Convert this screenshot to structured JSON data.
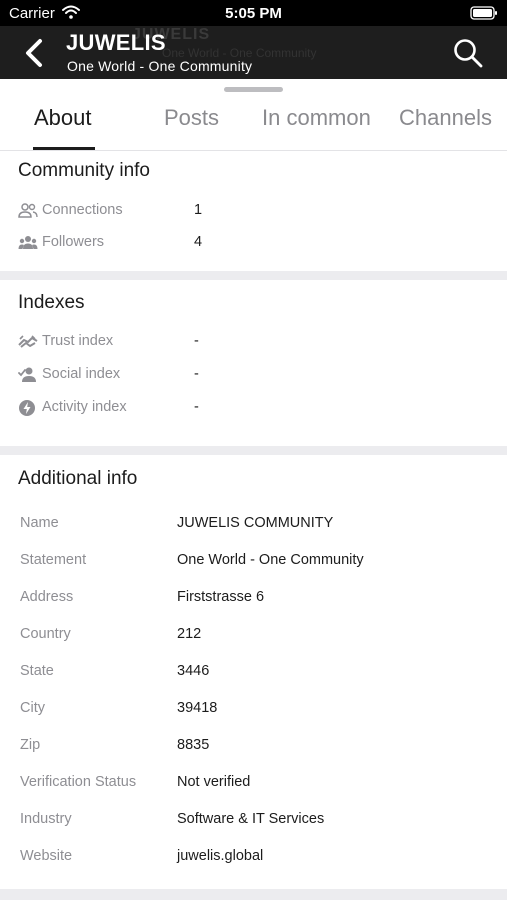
{
  "status_bar": {
    "carrier": "Carrier",
    "time": "5:05 PM",
    "wifi_icon": "wifi-icon",
    "battery_icon": "battery-icon"
  },
  "header": {
    "title": "JUWELIS",
    "subtitle": "One World - One Community",
    "back_icon": "chevron-left-icon",
    "search_icon": "search-icon"
  },
  "tabs": [
    {
      "label": "About",
      "active": true
    },
    {
      "label": "Posts",
      "active": false
    },
    {
      "label": "In common",
      "active": false
    },
    {
      "label": "Channels",
      "active": false
    }
  ],
  "community_info": {
    "title": "Community info",
    "rows": [
      {
        "icon": "connections-icon",
        "label": "Connections",
        "value": "1"
      },
      {
        "icon": "followers-icon",
        "label": "Followers",
        "value": "4"
      }
    ]
  },
  "indexes": {
    "title": "Indexes",
    "rows": [
      {
        "icon": "trust-handshake-icon",
        "label": "Trust index",
        "value": "-"
      },
      {
        "icon": "social-person-icon",
        "label": "Social index",
        "value": "-"
      },
      {
        "icon": "activity-bolt-icon",
        "label": "Activity index",
        "value": "-"
      }
    ]
  },
  "additional_info": {
    "title": "Additional info",
    "rows": [
      {
        "label": "Name",
        "value": "JUWELIS COMMUNITY"
      },
      {
        "label": "Statement",
        "value": "One World - One Community"
      },
      {
        "label": "Address",
        "value": "Firststrasse 6"
      },
      {
        "label": "Country",
        "value": "212"
      },
      {
        "label": "State",
        "value": "3446"
      },
      {
        "label": "City",
        "value": "39418"
      },
      {
        "label": "Zip",
        "value": "8835"
      },
      {
        "label": "Verification Status",
        "value": "Not verified"
      },
      {
        "label": "Industry",
        "value": "Software & IT Services"
      },
      {
        "label": "Website",
        "value": "juwelis.global"
      }
    ]
  }
}
